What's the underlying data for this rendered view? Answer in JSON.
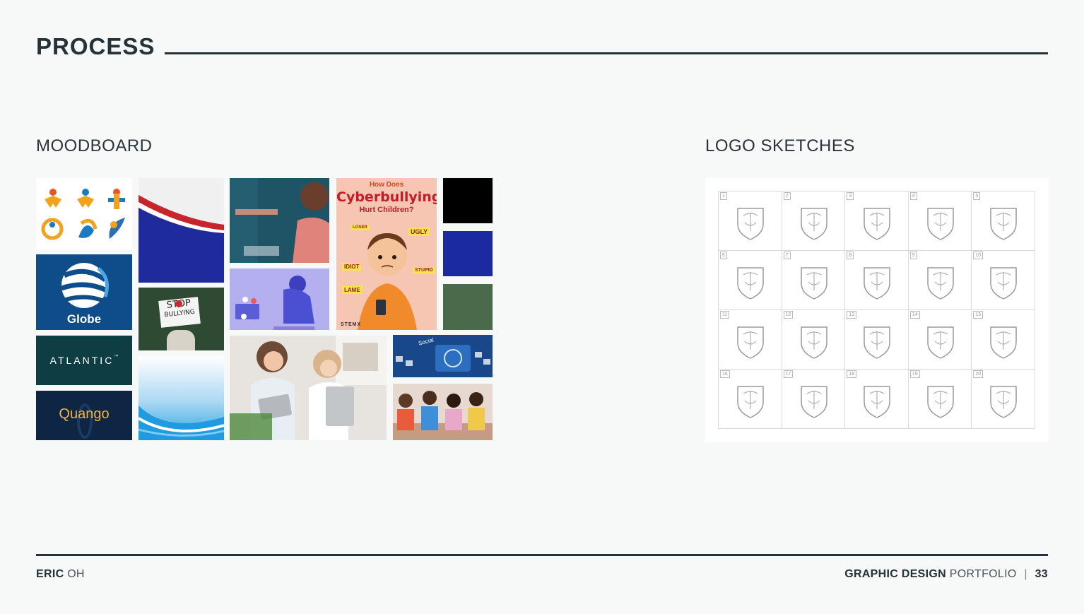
{
  "header": {
    "title": "PROCESS"
  },
  "moodboard": {
    "heading": "MOODBOARD",
    "logo_labels": {
      "globe": "Globe",
      "atlantic": "ATLANTIC",
      "atlantic_tm": "™",
      "quango": "Quango"
    },
    "stop_bullying_sign": {
      "line1": "STOP",
      "line2": "BULLYING"
    },
    "poster": {
      "line1": "How Does",
      "line2": "Cyberbullying",
      "line3": "Hurt Children?",
      "words": [
        "LOSER",
        "UGLY",
        "IDIOT",
        "STUPID",
        "LAME"
      ],
      "brand": "STEMX"
    },
    "social_tile_label": "Social",
    "swatches": [
      "#000000",
      "#1b2aa0",
      "#4a6b4b"
    ]
  },
  "logo_sketches": {
    "heading": "LOGO SKETCHES",
    "cell_numbers": [
      "1",
      "2",
      "3",
      "4",
      "5",
      "6",
      "7",
      "8",
      "9",
      "10",
      "11",
      "12",
      "13",
      "14",
      "15",
      "16",
      "17",
      "18",
      "19",
      "20"
    ]
  },
  "footer": {
    "author_first": "ERIC",
    "author_last": "OH",
    "portfolio_bold": "GRAPHIC DESIGN",
    "portfolio_light": "PORTFOLIO",
    "separator": "|",
    "page_number": "33"
  }
}
